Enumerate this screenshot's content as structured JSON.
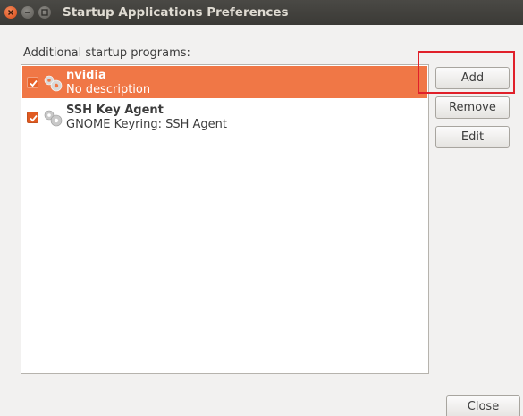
{
  "window": {
    "title": "Startup Applications Preferences"
  },
  "section_label": "Additional startup programs:",
  "programs": [
    {
      "name": "nvidia",
      "description": "No description",
      "enabled": true,
      "selected": true
    },
    {
      "name": "SSH Key Agent",
      "description": "GNOME Keyring: SSH Agent",
      "enabled": true,
      "selected": false
    }
  ],
  "buttons": {
    "add": "Add",
    "remove": "Remove",
    "edit": "Edit",
    "close": "Close"
  },
  "colors": {
    "accent": "#f07746",
    "titlebar": "#3b3a36",
    "highlight_box": "#e0202a"
  },
  "icons": {
    "program_icon": "gears-icon",
    "checkbox": "checkmark-icon"
  }
}
